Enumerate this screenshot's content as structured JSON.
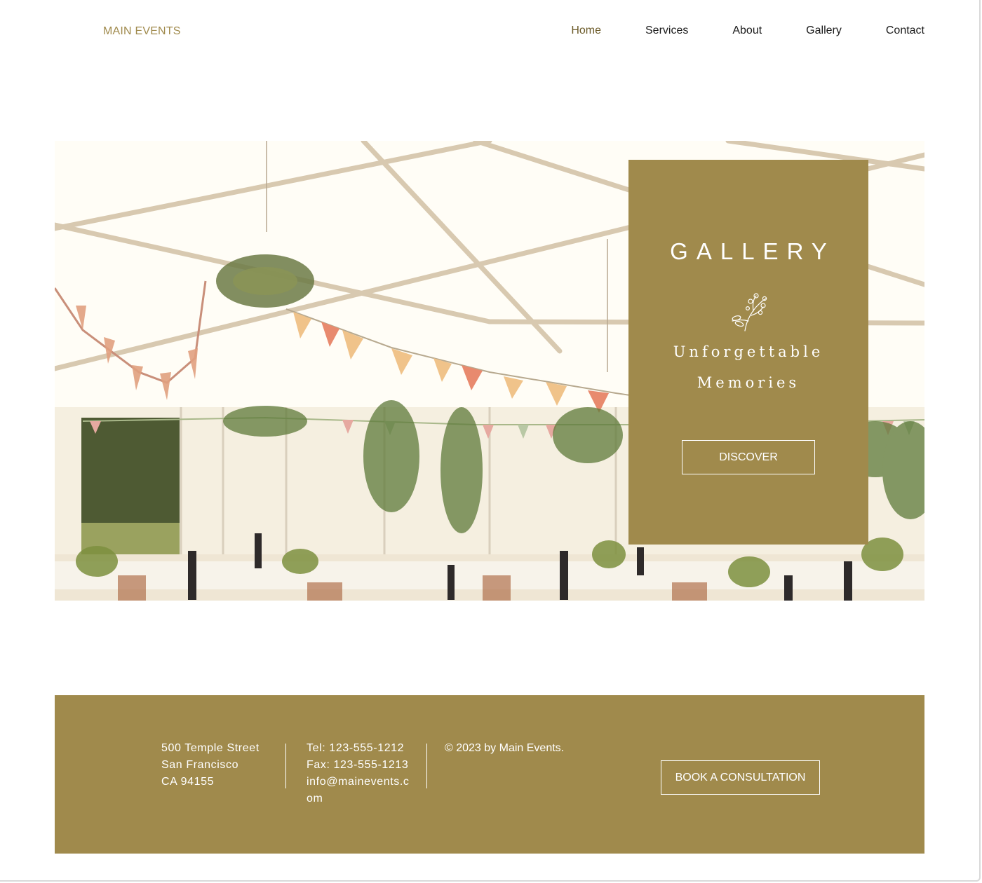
{
  "header": {
    "logo": "MAIN EVENTS",
    "nav": [
      "Home",
      "Services",
      "About",
      "Gallery",
      "Contact"
    ],
    "active": "Home"
  },
  "hero": {
    "image": "event-tent-photo",
    "card": {
      "title": "GALLERY",
      "icon": "sprig-icon",
      "subtitle_line1": "Unforgettable",
      "subtitle_line2": "Memories",
      "button": "DISCOVER"
    }
  },
  "footer": {
    "address": [
      "500 Temple Street",
      "San Francisco",
      "CA 94155"
    ],
    "contact": [
      "Tel: 123-555-1212",
      "Fax: 123-555-1213",
      "info@mainevents.com"
    ],
    "copyright": "© 2023 by Main Events.",
    "button": "BOOK A CONSULTATION"
  },
  "colors": {
    "accent": "#a08a4c",
    "nav_active": "#6b5a28",
    "text": "#1a1a1a",
    "background": "#ffffff"
  }
}
